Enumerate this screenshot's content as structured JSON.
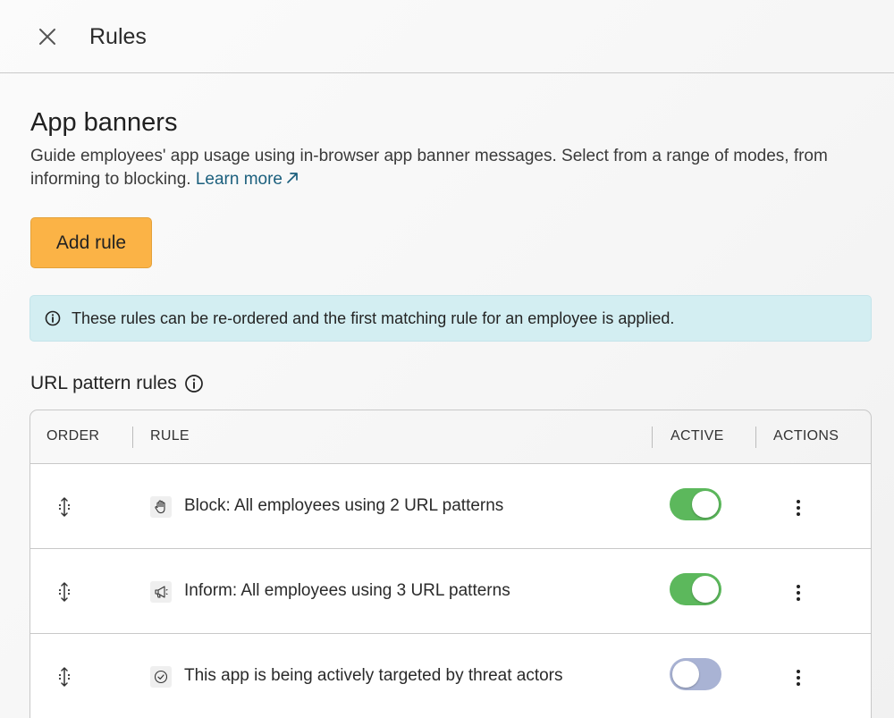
{
  "header": {
    "title": "Rules",
    "close_icon": "close-icon"
  },
  "section": {
    "title": "App banners",
    "description": "Guide employees' app usage using in-browser app banner messages. Select from a range of modes, from informing to blocking. ",
    "learn_more": "Learn more",
    "add_rule_label": "Add rule",
    "add_rule_color": "#fbb346"
  },
  "info_banner": {
    "text": "These rules can be re-ordered and the first matching rule for an employee is applied.",
    "icon": "info-icon",
    "background": "#d3eef2"
  },
  "url_rules": {
    "title": "URL pattern rules",
    "columns": {
      "order": "ORDER",
      "rule": "RULE",
      "active": "ACTIVE",
      "actions": "ACTIONS"
    },
    "rows": [
      {
        "rule": "Block: All employees using 2 URL patterns",
        "icon": "hand-block-icon",
        "active": true
      },
      {
        "rule": "Inform: All employees using 3 URL patterns",
        "icon": "megaphone-icon",
        "active": true
      },
      {
        "rule": "This app is being actively targeted by threat actors",
        "icon": "check-circle-icon",
        "active": false
      }
    ]
  },
  "colors": {
    "toggle_on": "#5cb85c",
    "toggle_off": "#a9b3d4",
    "link": "#1b5f7d"
  }
}
